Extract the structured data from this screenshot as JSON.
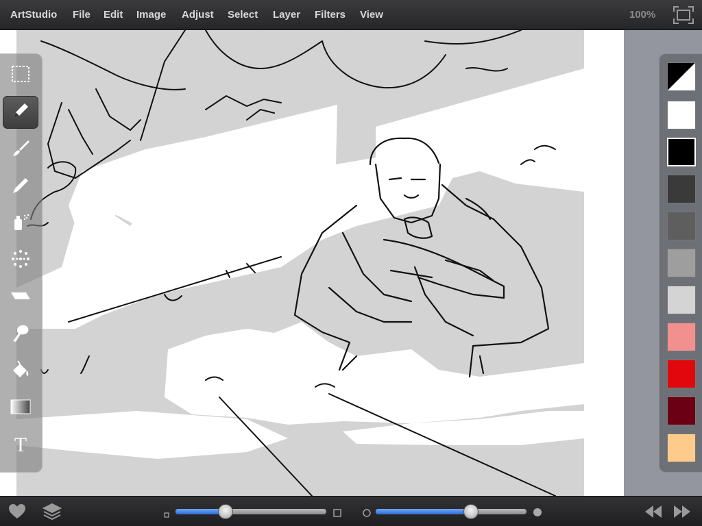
{
  "menubar": {
    "app_name": "ArtStudio",
    "menus": [
      "File",
      "Edit",
      "Image",
      "Adjust",
      "Select",
      "Layer",
      "Filters",
      "View"
    ],
    "zoom": "100%"
  },
  "canvas": {
    "content": "grey-and-white sketch illustration of a soldier aiming a rifle",
    "bg_color": "#d3d3d3"
  },
  "tools": [
    {
      "name": "selection-tool",
      "icon": "dashed-rectangle-icon"
    },
    {
      "name": "pencil-tool",
      "icon": "pencil-icon",
      "active": true
    },
    {
      "name": "brush-tool",
      "icon": "paintbrush-icon"
    },
    {
      "name": "pen-tool",
      "icon": "pen-icon"
    },
    {
      "name": "airbrush-tool",
      "icon": "spray-can-icon"
    },
    {
      "name": "spatter-tool",
      "icon": "spatter-dots-icon"
    },
    {
      "name": "eraser-tool",
      "icon": "eraser-icon"
    },
    {
      "name": "smudge-tool",
      "icon": "smudge-finger-icon"
    },
    {
      "name": "fill-tool",
      "icon": "paint-bucket-icon"
    },
    {
      "name": "gradient-tool",
      "icon": "gradient-icon"
    },
    {
      "name": "text-tool",
      "icon": "text-t-icon",
      "label": "T"
    }
  ],
  "palette": {
    "swatches": [
      "#000000/#ffffff",
      "#ffffff",
      "#000000",
      "#3a3a3a",
      "#5e5e5e",
      "#9e9e9e",
      "#d4d4d4",
      "#f29090",
      "#e0080d",
      "#6b0014",
      "#ffcb8c"
    ],
    "selected_index": 2
  },
  "bottombar": {
    "size_slider": {
      "value": 0.33,
      "min_icon": "small-square-icon",
      "max_icon": "large-square-icon"
    },
    "opacity_slider": {
      "value": 0.63,
      "min_icon": "small-circle-icon",
      "max_icon": "large-circle-icon"
    },
    "left_icons": [
      "heart-icon",
      "layers-icon"
    ],
    "right_icons": [
      "undo-icon",
      "redo-icon"
    ]
  }
}
